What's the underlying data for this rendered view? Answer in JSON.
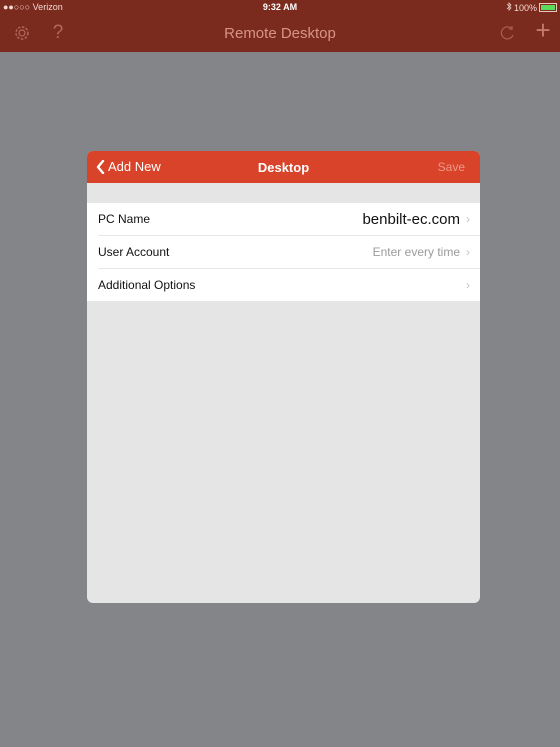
{
  "status_bar": {
    "carrier": "●●○○○ Verizon",
    "time": "9:32 AM",
    "battery": "100%",
    "colors": {
      "background": "#7b2a1e",
      "battery_fill": "#5cdc5c"
    }
  },
  "navbar": {
    "title": "Remote Desktop",
    "icons": [
      "gear-icon",
      "question-icon",
      "refresh-icon",
      "plus-icon"
    ],
    "question_glyph": "?",
    "plus_glyph": "+"
  },
  "modal": {
    "back_label": "Add New",
    "title": "Desktop",
    "save_label": "Save",
    "accent": "#d8432a",
    "rows": [
      {
        "label": "PC Name",
        "value": "benbilt-ec.com"
      },
      {
        "label": "User Account",
        "value": "Enter every time"
      },
      {
        "label": "Additional Options",
        "value": ""
      }
    ],
    "chevron": "›"
  }
}
